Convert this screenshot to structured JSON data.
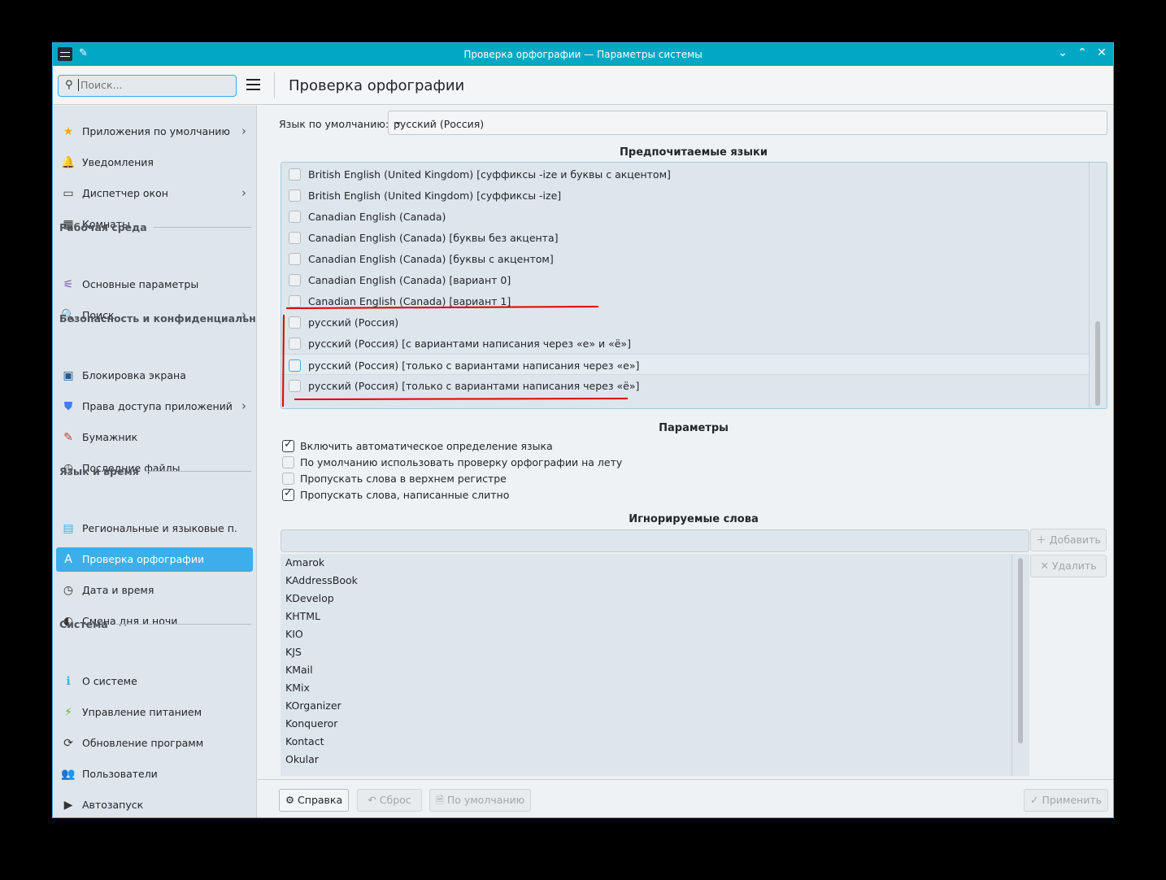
{
  "window": {
    "title": "Проверка орфографии — Параметры системы"
  },
  "header": {
    "search_placeholder": "Поиск...",
    "page_title": "Проверка орфографии"
  },
  "sidebar": {
    "items": [
      {
        "type": "item",
        "label": "Приложения по умолчанию",
        "icon": "star-icon",
        "glyph": "★",
        "color": "#f7a427",
        "chevron": true
      },
      {
        "type": "item",
        "label": "Уведомления",
        "icon": "bell-icon",
        "glyph": "🔔",
        "color": "#f0a030"
      },
      {
        "type": "item",
        "label": "Диспетчер окон",
        "icon": "window-icon",
        "glyph": "▭",
        "color": "#333",
        "chevron": true
      },
      {
        "type": "item",
        "label": "Комнаты",
        "icon": "activities-icon",
        "glyph": "▦",
        "color": "#333"
      },
      {
        "type": "head",
        "label": "Рабочая среда"
      },
      {
        "type": "item",
        "label": "Основные параметры",
        "icon": "settings-icon",
        "glyph": "⚟",
        "color": "#7a4fa8"
      },
      {
        "type": "item",
        "label": "Поиск",
        "icon": "search-icon",
        "glyph": "🔍",
        "color": "#3daee9",
        "chevron": true
      },
      {
        "type": "head",
        "label": "Безопасность и конфиденциальн..."
      },
      {
        "type": "item",
        "label": "Блокировка экрана",
        "icon": "lock-screen-icon",
        "glyph": "▣",
        "color": "#2d5a8a"
      },
      {
        "type": "item",
        "label": "Права доступа приложений",
        "icon": "shield-icon",
        "glyph": "⛊",
        "color": "#3d7ee9",
        "chevron": true
      },
      {
        "type": "item",
        "label": "Бумажник",
        "icon": "wallet-icon",
        "glyph": "✎",
        "color": "#c04030"
      },
      {
        "type": "item",
        "label": "Последние файлы",
        "icon": "clock-icon",
        "glyph": "◷",
        "color": "#333"
      },
      {
        "type": "head",
        "label": "Язык и время"
      },
      {
        "type": "item",
        "label": "Региональные и языковые п...",
        "icon": "region-icon",
        "glyph": "▤",
        "color": "#3daee9"
      },
      {
        "type": "item",
        "label": "Проверка орфографии",
        "icon": "spellcheck-icon",
        "glyph": "A",
        "color": "#fff",
        "active": true
      },
      {
        "type": "item",
        "label": "Дата и время",
        "icon": "clock-icon",
        "glyph": "◷",
        "color": "#333"
      },
      {
        "type": "item",
        "label": "Смена дня и ночи",
        "icon": "night-color-icon",
        "glyph": "◐",
        "color": "#333"
      },
      {
        "type": "head",
        "label": "Система"
      },
      {
        "type": "item",
        "label": "О системе",
        "icon": "info-icon",
        "glyph": "ℹ",
        "color": "#3daee9"
      },
      {
        "type": "item",
        "label": "Управление питанием",
        "icon": "power-icon",
        "glyph": "⚡",
        "color": "#5cb82e"
      },
      {
        "type": "item",
        "label": "Обновление программ",
        "icon": "update-icon",
        "glyph": "⟳",
        "color": "#333"
      },
      {
        "type": "item",
        "label": "Пользователи",
        "icon": "users-icon",
        "glyph": "👥",
        "color": "#3daee9"
      },
      {
        "type": "item",
        "label": "Автозапуск",
        "icon": "autostart-icon",
        "glyph": "▶",
        "color": "#333"
      }
    ]
  },
  "main": {
    "default_lang_label": "Язык по умолчанию:",
    "default_lang_value": "русский (Россия)",
    "preferred_title": "Предпочитаемые языки",
    "languages": [
      {
        "label": "British English (United Kingdom) [суффиксы -ize и буквы с акцентом]",
        "checked": false
      },
      {
        "label": "British English (United Kingdom) [суффиксы -ize]",
        "checked": false
      },
      {
        "label": "Canadian English (Canada)",
        "checked": false
      },
      {
        "label": "Canadian English (Canada) [буквы без акцента]",
        "checked": false
      },
      {
        "label": "Canadian English (Canada) [буквы с акцентом]",
        "checked": false
      },
      {
        "label": "Canadian English (Canada) [вариант 0]",
        "checked": false
      },
      {
        "label": "Canadian English (Canada) [вариант 1]",
        "checked": false
      },
      {
        "label": "русский (Россия)",
        "checked": false
      },
      {
        "label": "русский (Россия) [с вариантами написания через «е» и «ё»]",
        "checked": false
      },
      {
        "label": "русский (Россия) [только с вариантами написания через «е»]",
        "checked": false,
        "hover": true
      },
      {
        "label": "русский (Россия) [только с вариантами написания через «ё»]",
        "checked": false
      }
    ],
    "params_title": "Параметры",
    "options": [
      {
        "label": "Включить автоматическое определение языка",
        "checked": true
      },
      {
        "label": "По умолчанию использовать проверку орфографии на лету",
        "checked": false
      },
      {
        "label": "Пропускать слова в верхнем регистре",
        "checked": false
      },
      {
        "label": "Пропускать слова, написанные слитно",
        "checked": true
      }
    ],
    "ignored_title": "Игнорируемые слова",
    "add_label": "Добавить",
    "remove_label": "Удалить",
    "ignored_words": [
      "Amarok",
      "KAddressBook",
      "KDevelop",
      "KHTML",
      "KIO",
      "KJS",
      "KMail",
      "KMix",
      "KOrganizer",
      "Konqueror",
      "Kontact",
      "Okular"
    ]
  },
  "footer": {
    "help": "Справка",
    "reset": "Сброс",
    "defaults": "По умолчанию",
    "apply": "Применить"
  },
  "colors": {
    "accent": "#3daee9",
    "titlebar": "#00a8c6",
    "annotation": "#e00000"
  }
}
